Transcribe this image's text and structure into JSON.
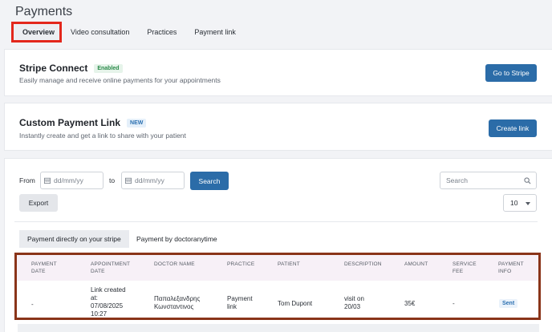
{
  "page": {
    "title": "Payments"
  },
  "tabs": [
    {
      "label": "Overview"
    },
    {
      "label": "Video consultation"
    },
    {
      "label": "Practices"
    },
    {
      "label": "Payment link"
    }
  ],
  "stripe": {
    "title": "Stripe Connect",
    "badge": "Enabled",
    "subtitle": "Easily manage and receive online payments for your appointments",
    "button": "Go to Stripe"
  },
  "custom_link": {
    "title": "Custom Payment Link",
    "badge": "NEW",
    "subtitle": "Instantly create and get a link to share with your patient",
    "button": "Create link"
  },
  "filters": {
    "from_label": "From",
    "to_label": "to",
    "date_placeholder": "dd/mm/yy",
    "search_button": "Search",
    "search_placeholder": "Search",
    "export_button": "Export",
    "page_size": "10"
  },
  "subtabs": [
    {
      "label": "Payment directly on your stripe"
    },
    {
      "label": "Payment by doctoranytime"
    }
  ],
  "table": {
    "headers": {
      "payment_date": [
        "PAYMENT",
        "DATE"
      ],
      "appointment_date": [
        "APPOINTMENT",
        "DATE"
      ],
      "doctor_name": [
        "DOCTOR NAME"
      ],
      "practice": [
        "PRACTICE"
      ],
      "patient": [
        "PATIENT"
      ],
      "description": [
        "DESCRIPTION"
      ],
      "amount": [
        "AMOUNT"
      ],
      "service_fee": [
        "SERVICE",
        "FEE"
      ],
      "payment_info": [
        "PAYMENT",
        "INFO"
      ]
    },
    "row": {
      "payment_date": "-",
      "appointment_date": [
        "Link created",
        "at:",
        "07/08/2025",
        "10:27"
      ],
      "doctor_name": [
        "Παπαλεξανδρης",
        "Κωνσταντινος"
      ],
      "practice": [
        "Payment",
        "link"
      ],
      "patient": "Tom Dupont",
      "description": [
        "visit on",
        "20/03"
      ],
      "amount": "35€",
      "service_fee": "-",
      "payment_info": "Sent"
    }
  },
  "colors": {
    "primary": "#2b6ca8",
    "highlight_red": "#e3271c",
    "highlight_brown": "#8a3419",
    "enabled_green": "#2b8a4a"
  }
}
